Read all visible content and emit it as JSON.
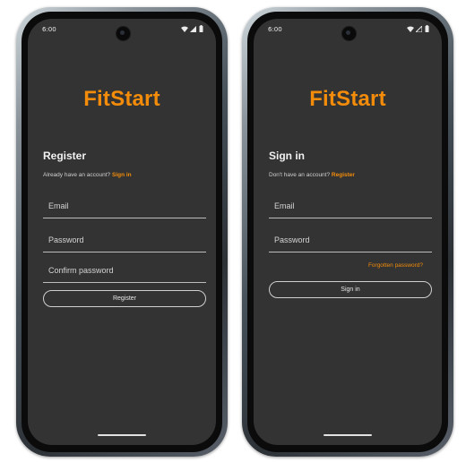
{
  "colors": {
    "accent": "#f28c0a",
    "screen_bg": "#333333",
    "text": "#e6e6e6"
  },
  "register_screen": {
    "status_time": "6:00",
    "brand": "FitStart",
    "title": "Register",
    "subtitle_prefix": "Already have an account?",
    "subtitle_link": "Sign in",
    "email_placeholder": "Email",
    "password_placeholder": "Password",
    "confirm_password_placeholder": "Confirm password",
    "submit_label": "Register"
  },
  "signin_screen": {
    "status_time": "6:00",
    "brand": "FitStart",
    "title": "Sign in",
    "subtitle_prefix": "Don't have an account?",
    "subtitle_link": "Register",
    "email_placeholder": "Email",
    "password_placeholder": "Password",
    "forgot_label": "Forgotten password?",
    "submit_label": "Sign in"
  },
  "status_icons": [
    "wifi-icon",
    "signal-icon",
    "battery-icon"
  ]
}
